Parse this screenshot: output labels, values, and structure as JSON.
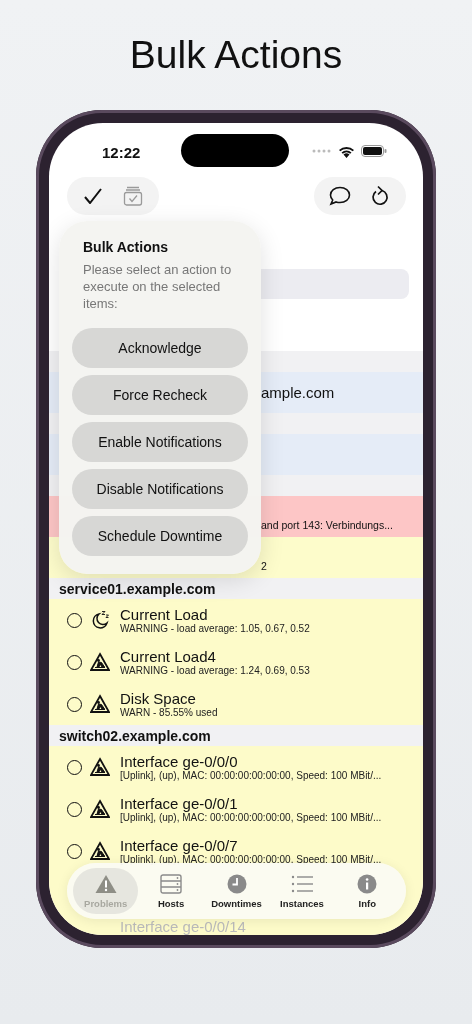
{
  "headline": "Bulk Actions",
  "status_bar": {
    "time": "12:22"
  },
  "toolbar": {
    "left": [
      {
        "kind": "check",
        "disabled": false
      },
      {
        "kind": "stack-check",
        "disabled": true
      }
    ],
    "right": [
      {
        "kind": "comment",
        "disabled": false
      },
      {
        "kind": "refresh",
        "disabled": false
      }
    ]
  },
  "background_sections": [
    {
      "rows": [
        {
          "color": "#e5ecf7",
          "title": "ample.com"
        }
      ]
    },
    {
      "rows": [
        {
          "color": "#e5ecf7"
        }
      ]
    },
    {
      "rows": [
        {
          "color": "#fdc6c6",
          "detail": "and port 143: Verbindungs..."
        },
        {
          "color": "#fdfccb",
          "detail": "2"
        }
      ]
    }
  ],
  "popover": {
    "title": "Bulk Actions",
    "message": "Please select an action to execute on the selected items:",
    "actions": [
      "Acknowledge",
      "Force Recheck",
      "Enable Notifications",
      "Disable Notifications",
      "Schedule Downtime"
    ]
  },
  "sections": [
    {
      "host": "service01.example.com",
      "rows": [
        {
          "kind": "downtime",
          "selected": false,
          "color": "#fdfbc9",
          "title": "Current Load",
          "detail": "WARNING - load average: 1.05, 0.67, 0.52"
        },
        {
          "kind": "warning",
          "selected": false,
          "color": "#fdfbc9",
          "title": "Current Load4",
          "detail": "WARNING - load average: 1.24, 0.69, 0.53"
        },
        {
          "kind": "warning",
          "selected": false,
          "color": "#fdfbc9",
          "title": "Disk Space",
          "detail": "WARN - 85.55% used"
        }
      ]
    },
    {
      "host": "switch02.example.com",
      "rows": [
        {
          "kind": "warning",
          "selected": false,
          "color": "#fdfbc9",
          "title": "Interface ge-0/0/0",
          "detail": "[Uplink], (up), MAC: 00:00:00:00:00:00, Speed: 100 MBit/..."
        },
        {
          "kind": "warning",
          "selected": false,
          "color": "#fdfbc9",
          "title": "Interface ge-0/0/1",
          "detail": "[Uplink], (up), MAC: 00:00:00:00:00:00, Speed: 100 MBit/..."
        },
        {
          "kind": "warning",
          "selected": false,
          "color": "#fdfbc9",
          "title": "Interface ge-0/0/7",
          "detail": "[Uplink], (up), MAC: 00:00:00:00:00:00, Speed: 100 MBit/..."
        }
      ]
    }
  ],
  "peek_row": {
    "title": "Interface ge-0/0/14"
  },
  "tab_bar": [
    {
      "kind": "problems",
      "label": "Problems",
      "selected": true
    },
    {
      "kind": "hosts",
      "label": "Hosts",
      "selected": false
    },
    {
      "kind": "downtimes",
      "label": "Downtimes",
      "selected": false
    },
    {
      "kind": "instances",
      "label": "Instances",
      "selected": false
    },
    {
      "kind": "info",
      "label": "Info",
      "selected": false
    }
  ]
}
